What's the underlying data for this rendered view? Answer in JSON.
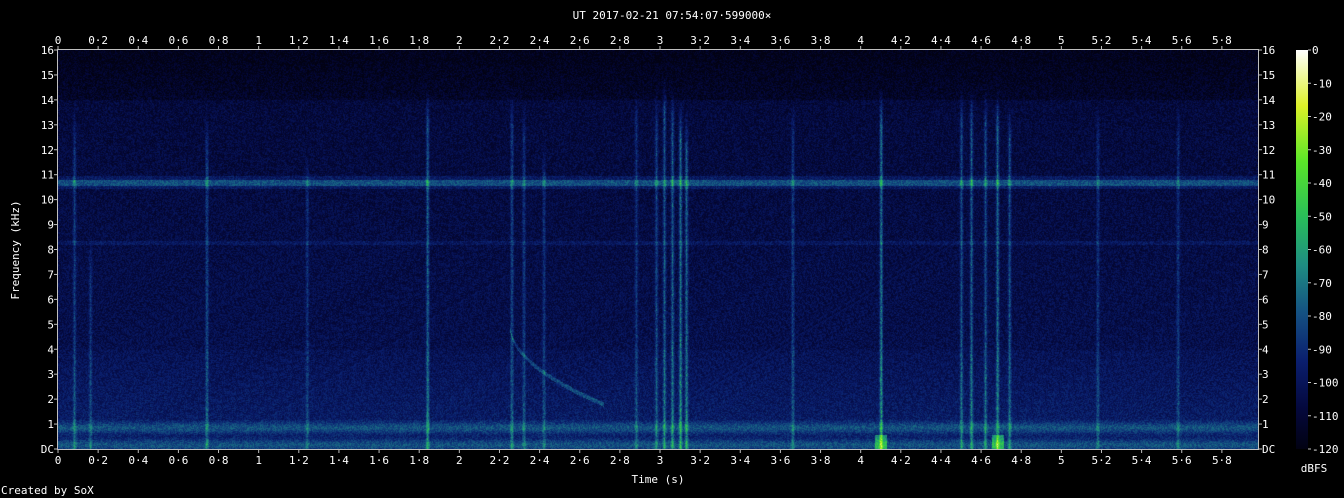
{
  "chart_data": {
    "type": "heatmap",
    "title": "UT 2017-02-21 07:54:07·599000×",
    "xlabel": "Time (s)",
    "ylabel": "Frequency (kHz)",
    "xlim": [
      0,
      5.98
    ],
    "ylim": [
      0,
      16
    ],
    "x_ticks": [
      "0",
      "0·2",
      "0·4",
      "0·6",
      "0·8",
      "1",
      "1·2",
      "1·4",
      "1·6",
      "1·8",
      "2",
      "2·2",
      "2·4",
      "2·6",
      "2·8",
      "3",
      "3·2",
      "3·4",
      "3·6",
      "3·8",
      "4",
      "4·2",
      "4·4",
      "4·6",
      "4·8",
      "5",
      "5·2",
      "5·4",
      "5·6",
      "5·8"
    ],
    "y_ticks": [
      "DC",
      "1",
      "2",
      "3",
      "4",
      "5",
      "6",
      "7",
      "8",
      "9",
      "10",
      "11",
      "12",
      "13",
      "14",
      "15",
      "16"
    ],
    "colorbar": {
      "label": "dBFS",
      "ticks": [
        "0",
        "-10",
        "-20",
        "-30",
        "-40",
        "-50",
        "-60",
        "-70",
        "-80",
        "-90",
        "-100",
        "-110",
        "-120"
      ],
      "range": [
        -120,
        0
      ]
    },
    "credit": "Created by SoX",
    "features": {
      "steady_tone_khz": 10.7,
      "secondary_tone_khz": 8.3,
      "low_band_khz": [
        0,
        1.2
      ],
      "transients": [
        {
          "t": 0.08,
          "top": 14.0,
          "strength": 0.55
        },
        {
          "t": 0.16,
          "top": 8.5,
          "strength": 0.45
        },
        {
          "t": 0.74,
          "top": 13.5,
          "strength": 0.65
        },
        {
          "t": 1.24,
          "top": 12.0,
          "strength": 0.45
        },
        {
          "t": 1.84,
          "top": 14.5,
          "strength": 0.85
        },
        {
          "t": 2.26,
          "top": 14.5,
          "strength": 0.65
        },
        {
          "t": 2.32,
          "top": 14.0,
          "strength": 0.55
        },
        {
          "t": 2.42,
          "top": 12.5,
          "strength": 0.5
        },
        {
          "t": 2.88,
          "top": 14.5,
          "strength": 0.5
        },
        {
          "t": 2.98,
          "top": 14.5,
          "strength": 0.6
        },
        {
          "t": 3.02,
          "top": 15.0,
          "strength": 0.75
        },
        {
          "t": 3.06,
          "top": 14.5,
          "strength": 0.8
        },
        {
          "t": 3.1,
          "top": 14.0,
          "strength": 0.95
        },
        {
          "t": 3.13,
          "top": 13.5,
          "strength": 0.85
        },
        {
          "t": 3.66,
          "top": 14.0,
          "strength": 0.6
        },
        {
          "t": 4.1,
          "top": 14.5,
          "strength": 1.0
        },
        {
          "t": 4.5,
          "top": 14.5,
          "strength": 0.7
        },
        {
          "t": 4.55,
          "top": 14.5,
          "strength": 0.8
        },
        {
          "t": 4.62,
          "top": 14.5,
          "strength": 0.7
        },
        {
          "t": 4.68,
          "top": 14.5,
          "strength": 0.9
        },
        {
          "t": 4.74,
          "top": 14.0,
          "strength": 0.7
        },
        {
          "t": 5.18,
          "top": 14.0,
          "strength": 0.5
        },
        {
          "t": 5.58,
          "top": 14.0,
          "strength": 0.5
        }
      ],
      "sweep": {
        "t_start": 2.25,
        "f_start": 5.0,
        "t_end": 2.72,
        "f_end": 1.8
      }
    }
  }
}
